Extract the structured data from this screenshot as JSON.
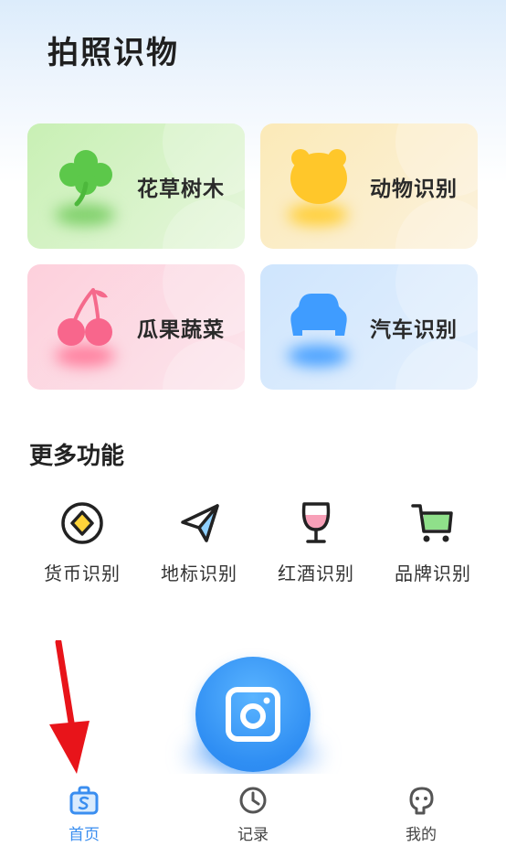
{
  "header": {
    "title": "拍照识物"
  },
  "cards": [
    {
      "label": "花草树木",
      "icon": "clover-icon"
    },
    {
      "label": "动物识别",
      "icon": "bear-icon"
    },
    {
      "label": "瓜果蔬菜",
      "icon": "cherry-icon"
    },
    {
      "label": "汽车识别",
      "icon": "car-icon"
    }
  ],
  "more": {
    "title": "更多功能",
    "items": [
      {
        "label": "货币识别",
        "icon": "coin-icon"
      },
      {
        "label": "地标识别",
        "icon": "paper-plane-icon"
      },
      {
        "label": "红酒识别",
        "icon": "wine-glass-icon"
      },
      {
        "label": "品牌识别",
        "icon": "shopping-cart-icon"
      }
    ]
  },
  "camera": {
    "icon": "camera-icon"
  },
  "nav": {
    "items": [
      {
        "label": "首页",
        "icon": "home-bag-icon",
        "active": true
      },
      {
        "label": "记录",
        "icon": "clock-icon",
        "active": false
      },
      {
        "label": "我的",
        "icon": "profile-face-icon",
        "active": false
      }
    ]
  },
  "colors": {
    "accent": "#3a8ef0",
    "plant_card": "#c8f0b4",
    "animal_card": "#fbeab8",
    "fruit_card": "#fdd0dc",
    "car_card": "#cfe5fd",
    "annotation_arrow": "#e8141a"
  }
}
